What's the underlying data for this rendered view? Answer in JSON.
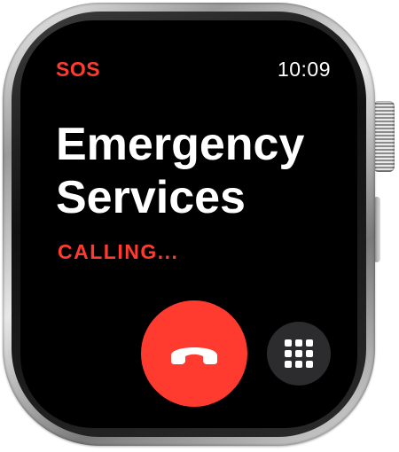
{
  "status_bar": {
    "sos_label": "SOS",
    "time": "10:09"
  },
  "call": {
    "title_line1": "Emergency",
    "title_line2": "Services",
    "status": "CALLING..."
  },
  "controls": {
    "end_call_icon": "phone-hangup-icon",
    "keypad_icon": "keypad-grid-icon"
  },
  "colors": {
    "accent_red": "#ff3b30",
    "background": "#000000",
    "keypad_button": "#2c2c2e",
    "text": "#ffffff"
  }
}
